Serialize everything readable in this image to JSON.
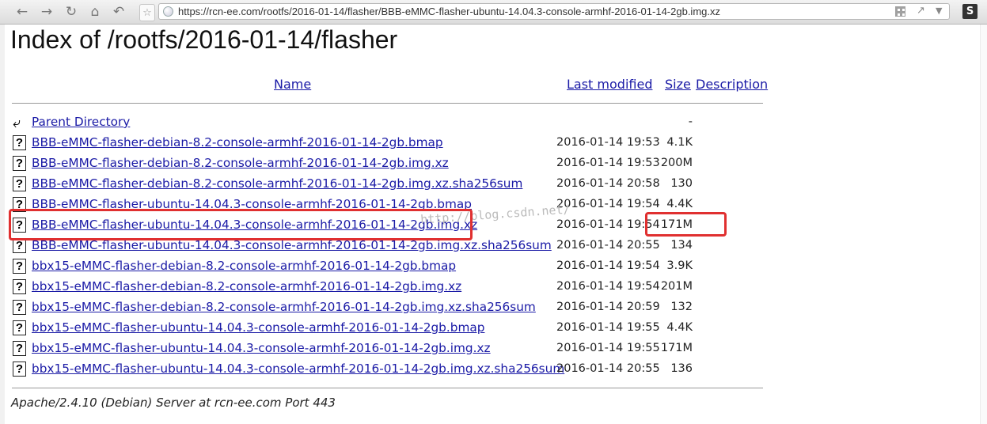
{
  "browser": {
    "url": "https://rcn-ee.com/rootfs/2016-01-14/flasher/BBB-eMMC-flasher-ubuntu-14.04.3-console-armhf-2016-01-14-2gb.img.xz",
    "extension_badge": "S",
    "icons": [
      "back-icon",
      "forward-icon",
      "reload-icon",
      "home-icon",
      "undo-icon",
      "star-icon",
      "globe-icon",
      "qr-icon",
      "share-icon",
      "dropdown-icon"
    ]
  },
  "page": {
    "title": "Index of /rootfs/2016-01-14/flasher",
    "columns": {
      "name": "Name",
      "last_modified": "Last modified",
      "size": "Size",
      "description": "Description"
    },
    "parent": {
      "label": "Parent Directory",
      "size": "-"
    },
    "files": [
      {
        "name": "BBB-eMMC-flasher-debian-8.2-console-armhf-2016-01-14-2gb.bmap",
        "modified": "2016-01-14 19:53",
        "size": "4.1K"
      },
      {
        "name": "BBB-eMMC-flasher-debian-8.2-console-armhf-2016-01-14-2gb.img.xz",
        "modified": "2016-01-14 19:53",
        "size": "200M"
      },
      {
        "name": "BBB-eMMC-flasher-debian-8.2-console-armhf-2016-01-14-2gb.img.xz.sha256sum",
        "modified": "2016-01-14 20:58",
        "size": "130"
      },
      {
        "name": "BBB-eMMC-flasher-ubuntu-14.04.3-console-armhf-2016-01-14-2gb.bmap",
        "modified": "2016-01-14 19:54",
        "size": "4.4K"
      },
      {
        "name": "BBB-eMMC-flasher-ubuntu-14.04.3-console-armhf-2016-01-14-2gb.img.xz",
        "modified": "2016-01-14 19:54",
        "size": "171M"
      },
      {
        "name": "BBB-eMMC-flasher-ubuntu-14.04.3-console-armhf-2016-01-14-2gb.img.xz.sha256sum",
        "modified": "2016-01-14 20:55",
        "size": "134"
      },
      {
        "name": "bbx15-eMMC-flasher-debian-8.2-console-armhf-2016-01-14-2gb.bmap",
        "modified": "2016-01-14 19:54",
        "size": "3.9K"
      },
      {
        "name": "bbx15-eMMC-flasher-debian-8.2-console-armhf-2016-01-14-2gb.img.xz",
        "modified": "2016-01-14 19:54",
        "size": "201M"
      },
      {
        "name": "bbx15-eMMC-flasher-debian-8.2-console-armhf-2016-01-14-2gb.img.xz.sha256sum",
        "modified": "2016-01-14 20:59",
        "size": "132"
      },
      {
        "name": "bbx15-eMMC-flasher-ubuntu-14.04.3-console-armhf-2016-01-14-2gb.bmap",
        "modified": "2016-01-14 19:55",
        "size": "4.4K"
      },
      {
        "name": "bbx15-eMMC-flasher-ubuntu-14.04.3-console-armhf-2016-01-14-2gb.img.xz",
        "modified": "2016-01-14 19:55",
        "size": "171M"
      },
      {
        "name": "bbx15-eMMC-flasher-ubuntu-14.04.3-console-armhf-2016-01-14-2gb.img.xz.sha256sum",
        "modified": "2016-01-14 20:55",
        "size": "136"
      }
    ],
    "address": "Apache/2.4.10 (Debian) Server at rcn-ee.com Port 443",
    "watermark": "http://blog.csdn.net/"
  },
  "colors": {
    "link": "#1a1aa6",
    "highlight": "#e03030"
  }
}
